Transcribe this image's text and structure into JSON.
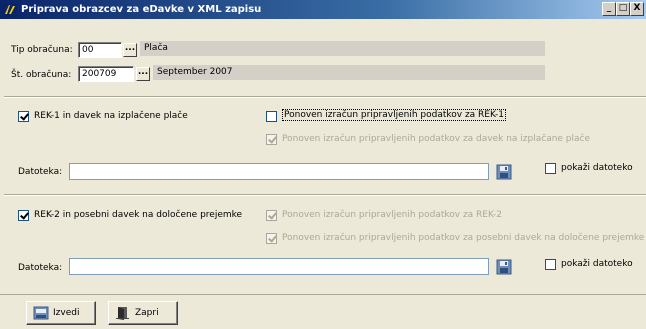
{
  "window": {
    "title": "Priprava obrazcev za eDavke v XML zapisu",
    "buttons": [
      "_",
      "□",
      "X"
    ]
  },
  "calc_type": {
    "label": "Tip obračuna:",
    "code": "00",
    "lookup_label": "...",
    "description": "Plača"
  },
  "calc_number": {
    "label": "Št. obračuna:",
    "code": "200709",
    "lookup_label": "...",
    "description": "September 2007"
  },
  "rek1": {
    "main_label": "REK-1 in davek na izplačene plače",
    "main_checked": true,
    "recalc_label": "Ponoven izračun pripravljenih podatkov za REK-1",
    "recalc_checked": false,
    "recalc_tax_label": "Ponoven izračun pripravljenih podatkov za davek na izplačane plače",
    "recalc_tax_checked": true,
    "file_label": "Datoteka:",
    "file_value": "",
    "show_file_label": "pokaži datoteko",
    "show_file_checked": false
  },
  "rek2": {
    "main_label": "REK-2 in posebni davek na določene prejemke",
    "main_checked": true,
    "recalc_label": "Ponoven izračun pripravljenih podatkov za REK-2",
    "recalc_checked": true,
    "recalc_tax_label": "Ponoven izračun pripravljenih podatkov za posebni davek na določene prejemke",
    "recalc_tax_checked": true,
    "file_label": "Datoteka:",
    "file_value": "",
    "show_file_label": "pokaži datoteko",
    "show_file_checked": false
  },
  "actions": {
    "run_label": "Izvedi",
    "close_label": "Zapri"
  },
  "icons": {
    "app": "app-logo-icon",
    "lookup": "ellipsis-icon",
    "file_browse": "save-disk-icon",
    "run": "run-icon",
    "close": "door-exit-icon"
  }
}
